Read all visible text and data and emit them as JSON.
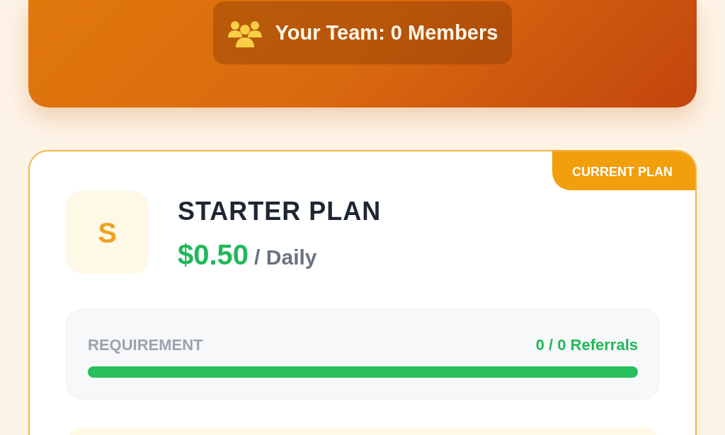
{
  "team_banner": {
    "text": "Your Team: 0 Members"
  },
  "plan": {
    "badge": "CURRENT PLAN",
    "current": true,
    "initial": "S",
    "title": "STARTER PLAN",
    "price": "$0.50",
    "period": "/ Daily",
    "requirement": {
      "label": "REQUIREMENT",
      "reading": "0 / 0 Referrals",
      "level": 1
    }
  }
}
